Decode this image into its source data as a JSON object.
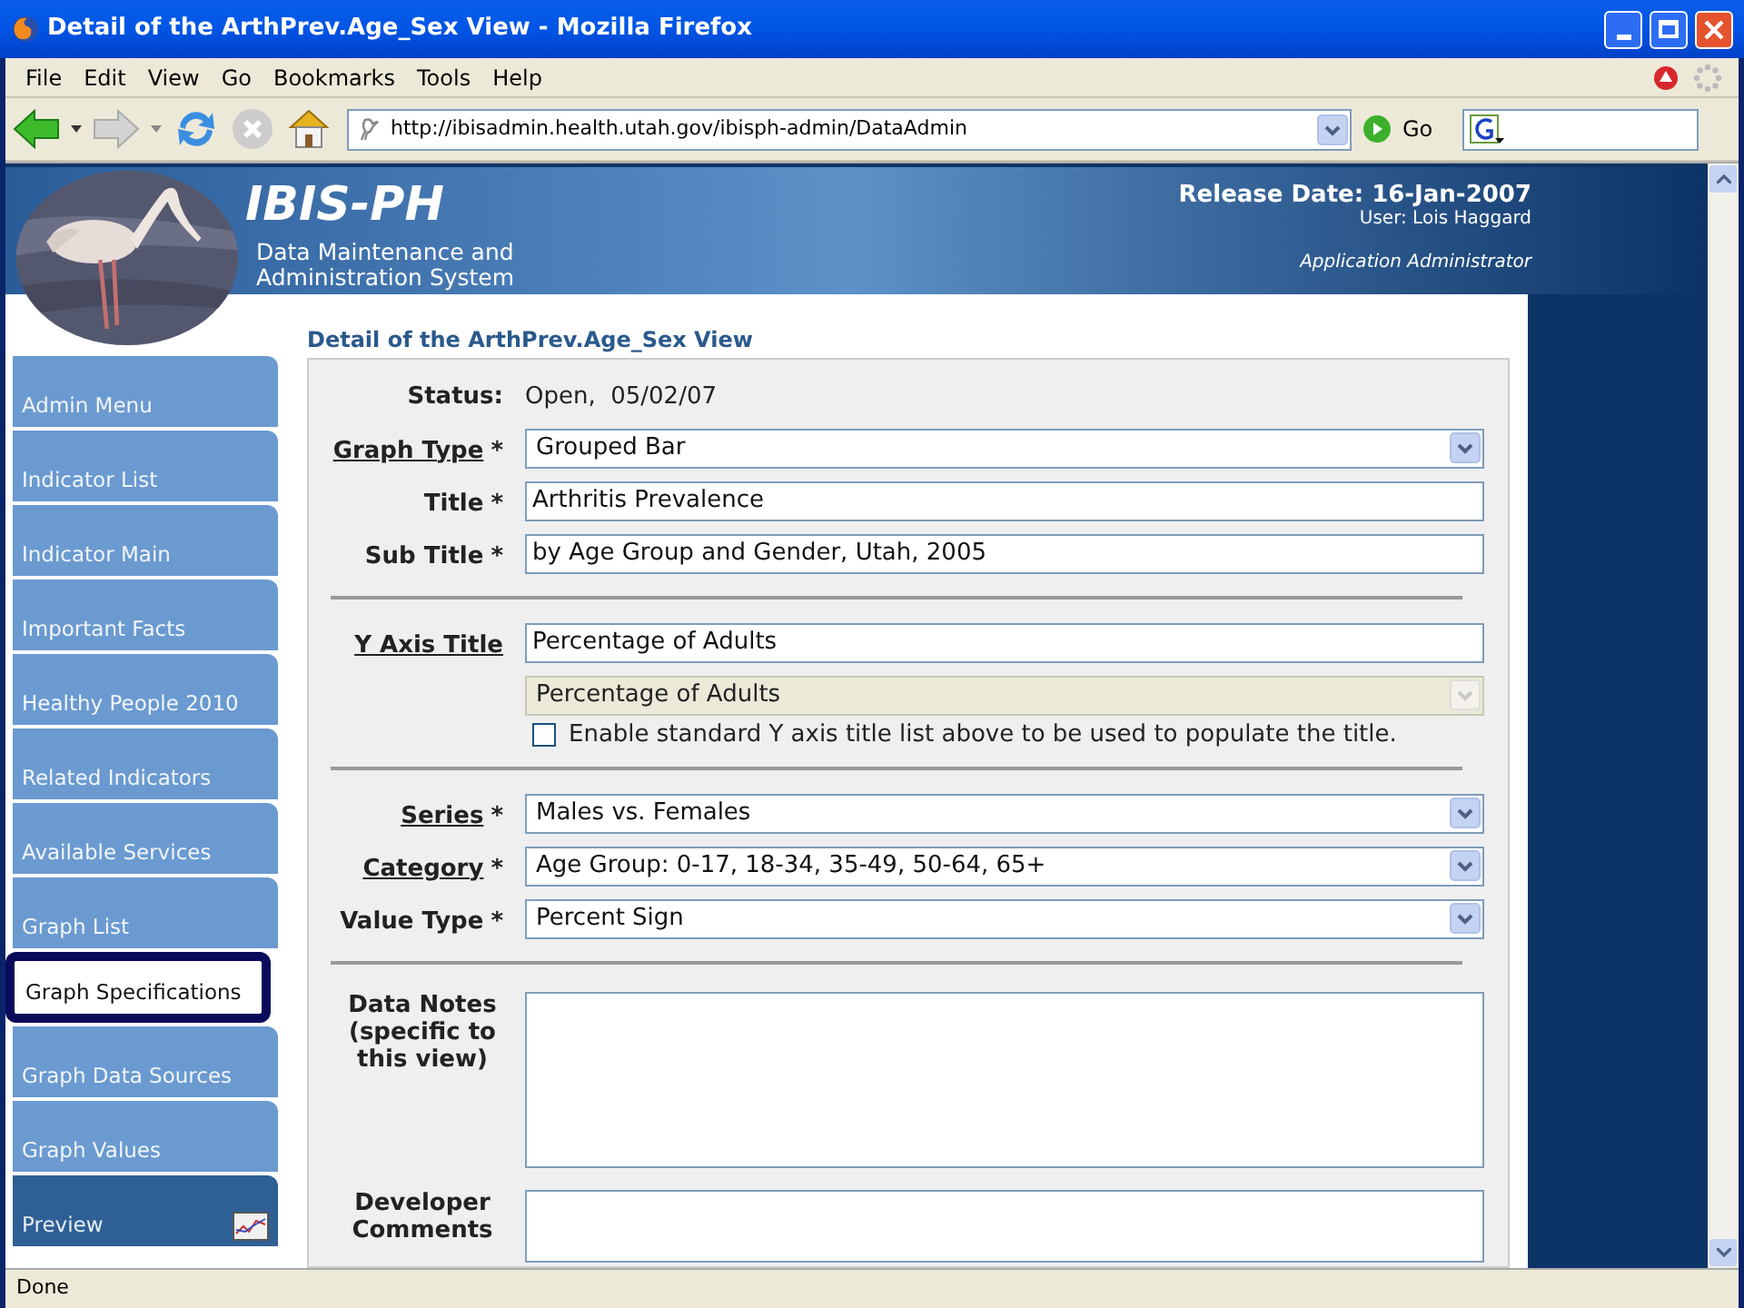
{
  "window": {
    "title": "Detail of the ArthPrev.Age_Sex View - Mozilla Firefox"
  },
  "menu": [
    "File",
    "Edit",
    "View",
    "Go",
    "Bookmarks",
    "Tools",
    "Help"
  ],
  "toolbar": {
    "address": "http://ibisadmin.health.utah.gov/ibisph-admin/DataAdmin",
    "go": "Go"
  },
  "header": {
    "brand": "IBIS-PH",
    "subtitle_1": "Data Maintenance and",
    "subtitle_2": "Administration System",
    "release": "Release Date: 16-Jan-2007",
    "user": "User: Lois Haggard",
    "role": "Application Administrator"
  },
  "sidebar": {
    "items": [
      {
        "label": "Admin Menu",
        "selected": false,
        "kind": "tab"
      },
      {
        "label": "Indicator List",
        "selected": false,
        "kind": "tab"
      },
      {
        "label": "Indicator Main",
        "selected": false,
        "kind": "tab"
      },
      {
        "label": "Important Facts",
        "selected": false,
        "kind": "tab"
      },
      {
        "label": "Healthy People 2010",
        "selected": false,
        "kind": "tab"
      },
      {
        "label": "Related Indicators",
        "selected": false,
        "kind": "tab"
      },
      {
        "label": "Available Services",
        "selected": false,
        "kind": "tab"
      },
      {
        "label": "Graph List",
        "selected": false,
        "kind": "tab"
      },
      {
        "label": "Graph Specifications",
        "selected": true,
        "kind": "tab"
      },
      {
        "label": "Graph Data Sources",
        "selected": false,
        "kind": "tab"
      },
      {
        "label": "Graph Values",
        "selected": false,
        "kind": "tab"
      },
      {
        "label": "Preview",
        "selected": false,
        "kind": "preview"
      }
    ]
  },
  "page_title": "Detail of the ArthPrev.Age_Sex View",
  "form": {
    "rows": [
      {
        "kind": "static",
        "label": "Status:",
        "value": "Open,  05/02/07"
      },
      {
        "kind": "select",
        "label": "Graph Type",
        "linked": true,
        "asterisk": "*",
        "disabled": false,
        "value": "Grouped Bar"
      },
      {
        "kind": "text",
        "label": "Title",
        "linked": false,
        "asterisk": "*",
        "value": "Arthritis Prevalence"
      },
      {
        "kind": "text",
        "label": "Sub Title",
        "linked": false,
        "asterisk": "*",
        "value": "by Age Group and Gender, Utah, 2005"
      },
      {
        "kind": "divider"
      },
      {
        "kind": "text",
        "label": "Y Axis Title",
        "linked": true,
        "value": "Percentage of Adults"
      },
      {
        "kind": "select",
        "disabled": true,
        "value": "Percentage of Adults"
      },
      {
        "kind": "checkbox",
        "checked": false,
        "value": "Enable standard Y axis title list above to be used to populate the title."
      },
      {
        "kind": "divider"
      },
      {
        "kind": "select",
        "label": "Series",
        "linked": true,
        "asterisk": "*",
        "disabled": false,
        "value": "Males vs. Females"
      },
      {
        "kind": "select",
        "label": "Category",
        "linked": true,
        "asterisk": "*",
        "disabled": false,
        "value": "Age Group: 0-17, 18-34, 35-49, 50-64, 65+"
      },
      {
        "kind": "select",
        "label": "Value Type",
        "linked": false,
        "asterisk": "*",
        "disabled": false,
        "value": "Percent Sign"
      },
      {
        "kind": "divider"
      },
      {
        "kind": "textarea",
        "label": "Data Notes (specific to this view)",
        "tall": true
      },
      {
        "kind": "textarea",
        "label": "Developer Comments",
        "tall": false
      }
    ]
  },
  "status_bar": "Done"
}
